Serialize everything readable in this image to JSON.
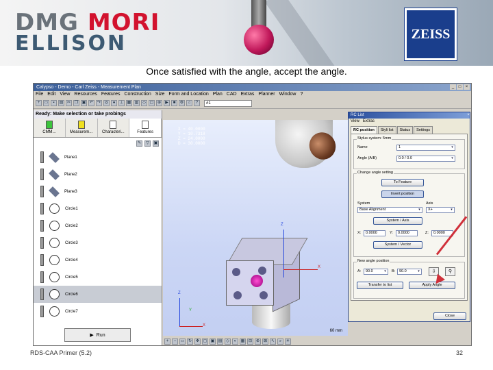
{
  "slide": {
    "caption": "Once satisfied with the angle, accept the angle.",
    "footer_left": "RDS-CAA Primer (5.2)",
    "page_number": "32",
    "logo_line1_a": "DMG",
    "logo_line1_b": "MORI",
    "logo_line2": "ELLISON",
    "zeiss_logo": "ZEISS",
    "colors": {
      "dmg_red": "#d2122e",
      "ellison_blue": "#3d5a73",
      "zeiss_blue": "#1a3e8c",
      "arrow_red": "#d0303a"
    }
  },
  "app": {
    "title": "Calypso - Demo - Carl Zeiss - Measurement Plan",
    "menu": [
      "File",
      "Edit",
      "View",
      "Resources",
      "Features",
      "Construction",
      "Size",
      "Form and Location",
      "Plan",
      "CAD",
      "Extras",
      "Planner",
      "Window",
      "?"
    ],
    "toolbar_select": "#1",
    "status": "Ready: Make selection or take probings",
    "tabs": [
      {
        "label": "CMM...",
        "color": "#3cc43c"
      },
      {
        "label": "Measurem...",
        "color": "#f0e020"
      },
      {
        "label": "Characteri...",
        "color": "#ffffff"
      },
      {
        "label": "Features",
        "color": "#ffffff"
      }
    ],
    "features": [
      {
        "label": "Plane1",
        "shape": "diamond"
      },
      {
        "label": "Plane2",
        "shape": "diamond"
      },
      {
        "label": "Plane3",
        "shape": "diamond"
      },
      {
        "label": "Circle1",
        "shape": "circle"
      },
      {
        "label": "Circle2",
        "shape": "circle"
      },
      {
        "label": "Circle3",
        "shape": "circle"
      },
      {
        "label": "Circle4",
        "shape": "circle"
      },
      {
        "label": "Circle5",
        "shape": "circle"
      },
      {
        "label": "Circle6",
        "shape": "circle"
      },
      {
        "label": "Circle7",
        "shape": "circle"
      }
    ],
    "run_button": "Run",
    "coords": "X = 40.0000\nY = 10.7318\nZ = 24.0000\nD = 30.0000",
    "axis_x": "X",
    "axis_y": "Y",
    "axis_z": "Z",
    "scale": "60 mm"
  },
  "dialog": {
    "title": "RC List",
    "menu": [
      "View",
      "Extras"
    ],
    "tabs": [
      "RC position",
      "Styli list",
      "Status",
      "Settings"
    ],
    "stylus_group": "Stylus system: 5mm",
    "name_label": "Name",
    "name_value": "1",
    "angle_label": "Angle (A/B)",
    "angle_value": "0.0 / 0.0",
    "change_group": "Change angle setting",
    "to_feature": "To Feature",
    "invert_position": "Invert position",
    "system_label": "System",
    "axis_label": "Axis",
    "system_value": "Base Alignment",
    "axis_value": "X+",
    "system_axis_btn": "System / Axis",
    "x_label": "X:",
    "x_value": "0.0000",
    "y_label": "Y:",
    "y_value": "0.0000",
    "z_label": "Z:",
    "z_value": "0.0000",
    "system_vector_btn": "System / Vector",
    "new_angle_group": "New angle position",
    "a_label": "A:",
    "a_value": "90.0",
    "b_label": "B:",
    "b_value": "90.0",
    "transfer_btn": "Transfer to list",
    "apply_btn": "Apply Angle",
    "close_btn": "Close"
  }
}
